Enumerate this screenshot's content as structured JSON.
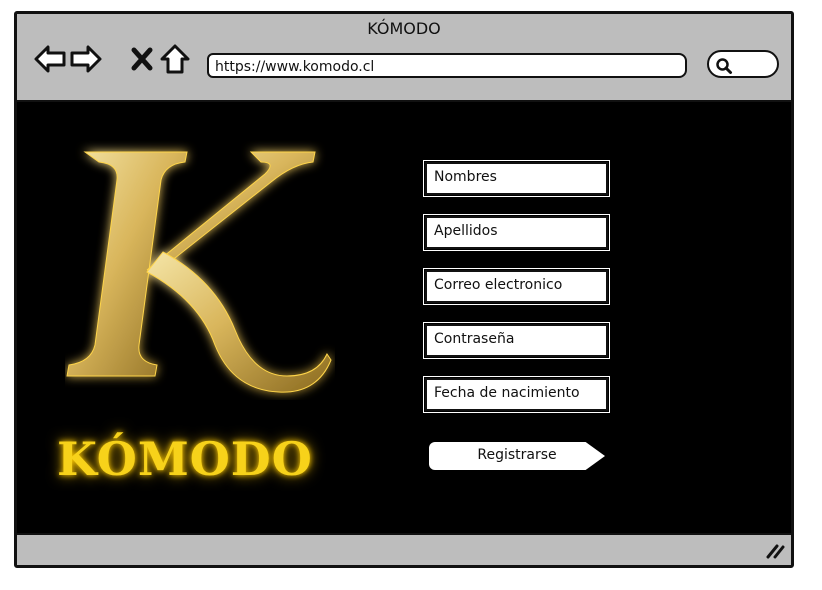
{
  "window": {
    "title": "KÓMODO"
  },
  "toolbar": {
    "back_icon": "arrow-left-icon",
    "forward_icon": "arrow-right-icon",
    "close_icon": "close-x-icon",
    "home_icon": "home-icon",
    "url": "https://www.komodo.cl",
    "search_icon": "search-icon"
  },
  "brand": {
    "logo_letter": "K",
    "name": "KÓMODO",
    "color_gold": "#f7d21a"
  },
  "form": {
    "fields": [
      {
        "label": "Nombres"
      },
      {
        "label": "Apellidos"
      },
      {
        "label": "Correo electronico"
      },
      {
        "label": "Contraseña"
      },
      {
        "label": "Fecha de nacimiento"
      }
    ],
    "submit_label": "Registrarse"
  }
}
